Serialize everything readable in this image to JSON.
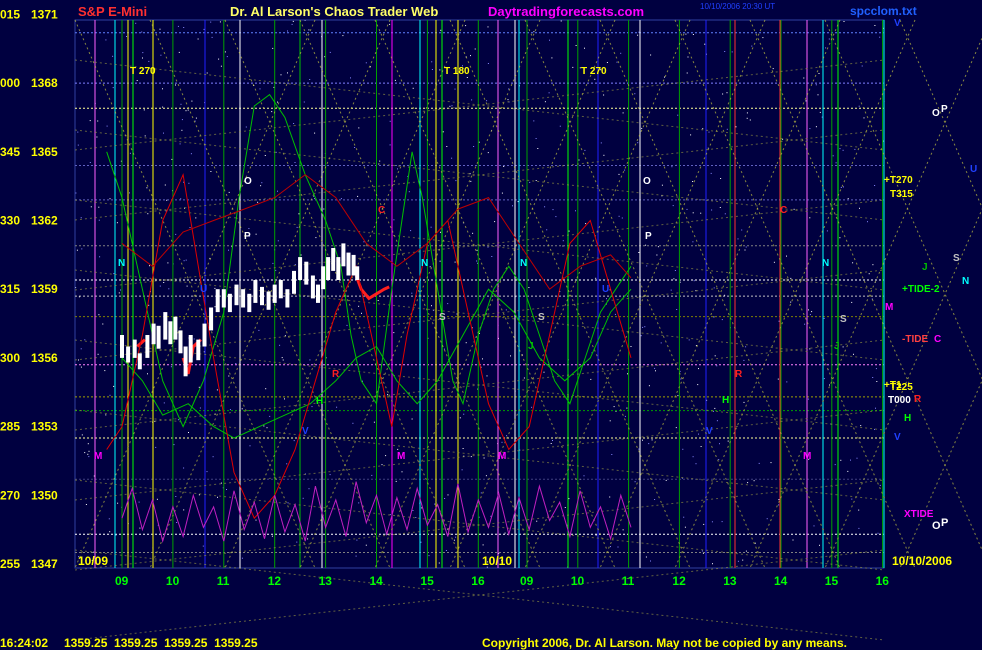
{
  "header": {
    "left_title": "S&P E-Mini",
    "center_title": "Dr. Al Larson's Chaos Trader Web",
    "site": "Daytradingforecasts.com",
    "timestamp_line1": "10/10/2006 20:30 UT",
    "timestamp_line2": "",
    "filename": "spcclom.txt"
  },
  "status_bar": {
    "time": "16:24:02",
    "quote": "1359.25  1359.25  1359.25  1359.25"
  },
  "copyright": "Copyright 2006, Dr. Al Larson. May not be copied by any means.",
  "date_labels": {
    "left": "10/09",
    "middle": "10/10",
    "right": "10/10/2006"
  },
  "colors": {
    "background": "#000040",
    "header_red": "#ff3030",
    "site_magenta": "#ff00ff",
    "axis_yellow": "#ffff00",
    "hour_green": "#00ff00",
    "price_white": "#ffffff"
  },
  "chart_data": {
    "type": "line",
    "title": "S&P E-Mini",
    "y_ticks": [
      {
        "code": "015",
        "price": 1371
      },
      {
        "code": "000",
        "price": 1368
      },
      {
        "code": "345",
        "price": 1365
      },
      {
        "code": "330",
        "price": 1362
      },
      {
        "code": "315",
        "price": 1359
      },
      {
        "code": "300",
        "price": 1356
      },
      {
        "code": "285",
        "price": 1353
      },
      {
        "code": "270",
        "price": 1350
      },
      {
        "code": "255",
        "price": 1347
      }
    ],
    "ylim": [
      1347,
      1371.5
    ],
    "x_ticks": [
      "09",
      "10",
      "11",
      "12",
      "13",
      "14",
      "15",
      "16",
      "09",
      "10",
      "11",
      "12",
      "13",
      "14",
      "15",
      "16"
    ],
    "t_labels": [
      "T 270",
      "T 180",
      "T 270"
    ],
    "right_labels": [
      "+T270",
      "T315",
      "J",
      "+TIDE-2",
      "-TIDE",
      "+T1",
      "T225",
      "T000",
      "R",
      "H",
      "V",
      "XTIDE",
      "O",
      "P",
      "U",
      "S",
      "N",
      "M",
      "C"
    ],
    "series": [
      {
        "kind": "bars",
        "color": "#ffffff",
        "points": [
          [
            0.0,
            1357.0,
            1356.0
          ],
          [
            0.12,
            1356.5,
            1355.8
          ],
          [
            0.25,
            1356.8,
            1356.0
          ],
          [
            0.35,
            1356.2,
            1355.5
          ],
          [
            0.5,
            1357.0,
            1356.0
          ],
          [
            0.62,
            1357.5,
            1356.6
          ],
          [
            0.72,
            1357.4,
            1356.4
          ],
          [
            0.85,
            1358.0,
            1356.8
          ],
          [
            0.95,
            1357.6,
            1356.6
          ],
          [
            1.05,
            1357.8,
            1356.8
          ],
          [
            1.15,
            1357.2,
            1356.2
          ],
          [
            1.25,
            1356.5,
            1355.2
          ],
          [
            1.35,
            1357.0,
            1355.8
          ],
          [
            1.5,
            1356.8,
            1355.9
          ],
          [
            1.62,
            1357.5,
            1356.5
          ],
          [
            1.75,
            1358.2,
            1357.2
          ],
          [
            1.88,
            1359.0,
            1358.0
          ],
          [
            2.0,
            1359.0,
            1358.2
          ],
          [
            2.12,
            1358.8,
            1358.0
          ],
          [
            2.25,
            1359.2,
            1358.3
          ],
          [
            2.38,
            1359.0,
            1358.2
          ],
          [
            2.5,
            1358.8,
            1358.0
          ],
          [
            2.62,
            1359.4,
            1358.4
          ],
          [
            2.75,
            1359.1,
            1358.3
          ],
          [
            2.88,
            1358.9,
            1358.1
          ],
          [
            3.0,
            1359.2,
            1358.4
          ],
          [
            3.12,
            1359.4,
            1358.6
          ],
          [
            3.25,
            1359.0,
            1358.2
          ],
          [
            3.38,
            1359.8,
            1358.8
          ],
          [
            3.5,
            1360.4,
            1359.4
          ],
          [
            3.62,
            1360.2,
            1359.2
          ],
          [
            3.75,
            1359.6,
            1358.6
          ],
          [
            3.85,
            1359.2,
            1358.4
          ],
          [
            3.95,
            1360.0,
            1359.0
          ],
          [
            4.05,
            1360.4,
            1359.4
          ],
          [
            4.15,
            1360.8,
            1359.8
          ],
          [
            4.25,
            1360.4,
            1359.4
          ],
          [
            4.35,
            1361.0,
            1360.0
          ],
          [
            4.45,
            1360.6,
            1359.6
          ],
          [
            4.55,
            1360.5,
            1359.6
          ],
          [
            4.62,
            1360.0,
            1359.4
          ]
        ]
      },
      {
        "kind": "red_segment",
        "color": "#ff2020",
        "points": [
          [
            4.6,
            1359.6
          ],
          [
            4.7,
            1359.0
          ],
          [
            4.85,
            1358.6
          ],
          [
            5.0,
            1358.8
          ],
          [
            5.15,
            1359.0
          ],
          [
            5.25,
            1359.1
          ]
        ]
      },
      {
        "kind": "red_segment_left",
        "color": "#ff2020",
        "points": [
          [
            0.3,
            1356.5
          ],
          [
            0.45,
            1356.8
          ]
        ]
      },
      {
        "kind": "red_segment_mid",
        "color": "#ff2020",
        "points": [
          [
            1.2,
            1356.0
          ],
          [
            1.3,
            1355.3
          ],
          [
            1.4,
            1356.5
          ],
          [
            1.55,
            1356.8
          ]
        ]
      },
      {
        "kind": "green_wave",
        "color": "#00c000",
        "points": [
          [
            -0.3,
            1365
          ],
          [
            0.0,
            1363
          ],
          [
            0.4,
            1359
          ],
          [
            0.8,
            1355
          ],
          [
            1.2,
            1353
          ],
          [
            1.6,
            1355
          ],
          [
            2.0,
            1358
          ],
          [
            2.3,
            1363
          ],
          [
            2.6,
            1367
          ],
          [
            2.9,
            1367.5
          ],
          [
            3.2,
            1366.5
          ],
          [
            3.6,
            1364
          ],
          [
            4.0,
            1362
          ],
          [
            4.3,
            1360
          ],
          [
            4.5,
            1357
          ],
          [
            4.7,
            1355
          ],
          [
            5.0,
            1354
          ],
          [
            5.3,
            1359
          ],
          [
            5.5,
            1362
          ],
          [
            5.7,
            1365
          ],
          [
            5.9,
            1363
          ],
          [
            6.2,
            1359
          ],
          [
            6.5,
            1355
          ],
          [
            6.7,
            1354
          ],
          [
            7.0,
            1357
          ],
          [
            7.3,
            1359
          ],
          [
            7.6,
            1360
          ],
          [
            7.9,
            1359
          ],
          [
            8.2,
            1357
          ],
          [
            8.5,
            1355
          ],
          [
            8.8,
            1354
          ],
          [
            9.1,
            1356
          ],
          [
            9.4,
            1358
          ],
          [
            9.7,
            1359
          ],
          [
            10.0,
            1360
          ]
        ]
      },
      {
        "kind": "green_wave2",
        "color": "#00c000",
        "points": [
          [
            0.0,
            1356
          ],
          [
            0.4,
            1355
          ],
          [
            0.8,
            1353.5
          ],
          [
            1.3,
            1354
          ],
          [
            1.8,
            1353
          ],
          [
            2.2,
            1352.5
          ],
          [
            2.7,
            1353
          ],
          [
            3.2,
            1353.5
          ],
          [
            3.7,
            1354
          ],
          [
            4.2,
            1355
          ],
          [
            4.6,
            1356
          ],
          [
            5.0,
            1356.5
          ],
          [
            5.4,
            1355
          ],
          [
            5.8,
            1354
          ],
          [
            6.2,
            1355
          ],
          [
            6.7,
            1357
          ],
          [
            7.2,
            1359
          ],
          [
            7.7,
            1358
          ],
          [
            8.2,
            1356
          ],
          [
            8.7,
            1355
          ],
          [
            9.2,
            1356
          ],
          [
            9.6,
            1358
          ],
          [
            10.0,
            1359
          ]
        ]
      },
      {
        "kind": "red_wave",
        "color": "#e00000",
        "points": [
          [
            -0.3,
            1352
          ],
          [
            0.0,
            1353
          ],
          [
            0.4,
            1357
          ],
          [
            0.8,
            1362
          ],
          [
            1.2,
            1364
          ],
          [
            1.5,
            1360
          ],
          [
            1.8,
            1356
          ],
          [
            2.2,
            1351
          ],
          [
            2.6,
            1349
          ],
          [
            3.0,
            1350
          ],
          [
            3.4,
            1352
          ],
          [
            3.8,
            1355
          ],
          [
            4.2,
            1358
          ],
          [
            4.6,
            1360
          ],
          [
            5.0,
            1356
          ],
          [
            5.3,
            1353
          ],
          [
            5.6,
            1357
          ],
          [
            6.0,
            1361
          ],
          [
            6.4,
            1362
          ],
          [
            6.8,
            1358
          ],
          [
            7.2,
            1354
          ],
          [
            7.6,
            1352
          ],
          [
            8.0,
            1353
          ],
          [
            8.4,
            1357
          ],
          [
            8.8,
            1361
          ],
          [
            9.2,
            1362
          ],
          [
            9.6,
            1359
          ],
          [
            10.0,
            1356
          ]
        ]
      },
      {
        "kind": "red_wave2",
        "color": "#c00000",
        "points": [
          [
            0.0,
            1361
          ],
          [
            0.6,
            1360
          ],
          [
            1.2,
            1361.5
          ],
          [
            1.8,
            1362
          ],
          [
            2.4,
            1362.5
          ],
          [
            3.0,
            1363
          ],
          [
            3.6,
            1364
          ],
          [
            4.2,
            1363
          ],
          [
            4.8,
            1361
          ],
          [
            5.4,
            1360
          ],
          [
            6.0,
            1361
          ],
          [
            6.6,
            1362.5
          ],
          [
            7.2,
            1363
          ],
          [
            7.8,
            1361
          ],
          [
            8.4,
            1359
          ],
          [
            9.0,
            1360
          ],
          [
            9.6,
            1360.5
          ],
          [
            10.0,
            1359.5
          ]
        ]
      },
      {
        "kind": "xtide",
        "color": "#c020c0",
        "points": [
          [
            0.0,
            1349
          ],
          [
            0.2,
            1350.3
          ],
          [
            0.4,
            1348.5
          ],
          [
            0.6,
            1349.8
          ],
          [
            0.8,
            1348
          ],
          [
            1.0,
            1349.5
          ],
          [
            1.2,
            1348.2
          ],
          [
            1.4,
            1350
          ],
          [
            1.6,
            1348.6
          ],
          [
            1.8,
            1349.5
          ],
          [
            2.0,
            1348
          ],
          [
            2.2,
            1350.2
          ],
          [
            2.4,
            1348.5
          ],
          [
            2.6,
            1349.7
          ],
          [
            2.8,
            1348.1
          ],
          [
            3.0,
            1350
          ],
          [
            3.2,
            1348.4
          ],
          [
            3.4,
            1349.6
          ],
          [
            3.6,
            1348
          ],
          [
            3.8,
            1350.4
          ],
          [
            4.0,
            1348.6
          ],
          [
            4.2,
            1349.8
          ],
          [
            4.4,
            1348.2
          ],
          [
            4.6,
            1350.6
          ],
          [
            4.8,
            1348.8
          ],
          [
            5.0,
            1350
          ],
          [
            5.2,
            1348.3
          ],
          [
            5.4,
            1349.9
          ],
          [
            5.6,
            1348.5
          ],
          [
            5.8,
            1350.3
          ],
          [
            6.0,
            1348.7
          ],
          [
            6.2,
            1349.6
          ],
          [
            6.4,
            1348.2
          ],
          [
            6.6,
            1350.5
          ],
          [
            6.8,
            1348.4
          ],
          [
            7.0,
            1349.8
          ],
          [
            7.2,
            1348.6
          ],
          [
            7.4,
            1350.1
          ],
          [
            7.6,
            1348.3
          ],
          [
            7.8,
            1349.9
          ],
          [
            8.0,
            1348.5
          ],
          [
            8.2,
            1350.4
          ],
          [
            8.4,
            1348.9
          ],
          [
            8.6,
            1349.7
          ],
          [
            8.8,
            1348.2
          ],
          [
            9.0,
            1350.2
          ],
          [
            9.2,
            1348.6
          ],
          [
            9.4,
            1349.5
          ],
          [
            9.6,
            1348.1
          ],
          [
            9.8,
            1350
          ],
          [
            10.0,
            1348.6
          ]
        ]
      }
    ]
  }
}
